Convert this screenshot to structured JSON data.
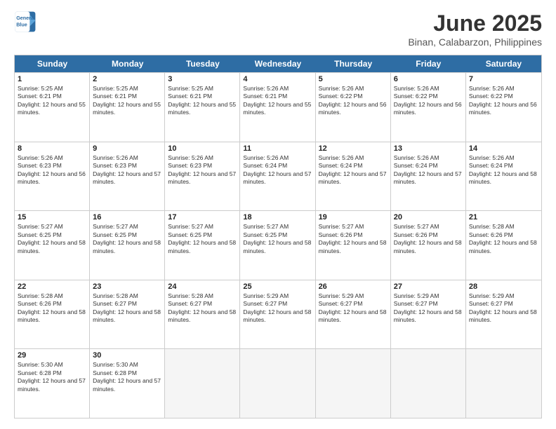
{
  "header": {
    "logo_line1": "General",
    "logo_line2": "Blue",
    "month": "June 2025",
    "location": "Binan, Calabarzon, Philippines"
  },
  "day_names": [
    "Sunday",
    "Monday",
    "Tuesday",
    "Wednesday",
    "Thursday",
    "Friday",
    "Saturday"
  ],
  "rows": [
    [
      {
        "date": "1",
        "sunrise": "5:25 AM",
        "sunset": "6:21 PM",
        "daylight": "12 hours and 55 minutes."
      },
      {
        "date": "2",
        "sunrise": "5:25 AM",
        "sunset": "6:21 PM",
        "daylight": "12 hours and 55 minutes."
      },
      {
        "date": "3",
        "sunrise": "5:25 AM",
        "sunset": "6:21 PM",
        "daylight": "12 hours and 55 minutes."
      },
      {
        "date": "4",
        "sunrise": "5:26 AM",
        "sunset": "6:21 PM",
        "daylight": "12 hours and 55 minutes."
      },
      {
        "date": "5",
        "sunrise": "5:26 AM",
        "sunset": "6:22 PM",
        "daylight": "12 hours and 56 minutes."
      },
      {
        "date": "6",
        "sunrise": "5:26 AM",
        "sunset": "6:22 PM",
        "daylight": "12 hours and 56 minutes."
      },
      {
        "date": "7",
        "sunrise": "5:26 AM",
        "sunset": "6:22 PM",
        "daylight": "12 hours and 56 minutes."
      }
    ],
    [
      {
        "date": "8",
        "sunrise": "5:26 AM",
        "sunset": "6:23 PM",
        "daylight": "12 hours and 56 minutes."
      },
      {
        "date": "9",
        "sunrise": "5:26 AM",
        "sunset": "6:23 PM",
        "daylight": "12 hours and 57 minutes."
      },
      {
        "date": "10",
        "sunrise": "5:26 AM",
        "sunset": "6:23 PM",
        "daylight": "12 hours and 57 minutes."
      },
      {
        "date": "11",
        "sunrise": "5:26 AM",
        "sunset": "6:24 PM",
        "daylight": "12 hours and 57 minutes."
      },
      {
        "date": "12",
        "sunrise": "5:26 AM",
        "sunset": "6:24 PM",
        "daylight": "12 hours and 57 minutes."
      },
      {
        "date": "13",
        "sunrise": "5:26 AM",
        "sunset": "6:24 PM",
        "daylight": "12 hours and 57 minutes."
      },
      {
        "date": "14",
        "sunrise": "5:26 AM",
        "sunset": "6:24 PM",
        "daylight": "12 hours and 58 minutes."
      }
    ],
    [
      {
        "date": "15",
        "sunrise": "5:27 AM",
        "sunset": "6:25 PM",
        "daylight": "12 hours and 58 minutes."
      },
      {
        "date": "16",
        "sunrise": "5:27 AM",
        "sunset": "6:25 PM",
        "daylight": "12 hours and 58 minutes."
      },
      {
        "date": "17",
        "sunrise": "5:27 AM",
        "sunset": "6:25 PM",
        "daylight": "12 hours and 58 minutes."
      },
      {
        "date": "18",
        "sunrise": "5:27 AM",
        "sunset": "6:25 PM",
        "daylight": "12 hours and 58 minutes."
      },
      {
        "date": "19",
        "sunrise": "5:27 AM",
        "sunset": "6:26 PM",
        "daylight": "12 hours and 58 minutes."
      },
      {
        "date": "20",
        "sunrise": "5:27 AM",
        "sunset": "6:26 PM",
        "daylight": "12 hours and 58 minutes."
      },
      {
        "date": "21",
        "sunrise": "5:28 AM",
        "sunset": "6:26 PM",
        "daylight": "12 hours and 58 minutes."
      }
    ],
    [
      {
        "date": "22",
        "sunrise": "5:28 AM",
        "sunset": "6:26 PM",
        "daylight": "12 hours and 58 minutes."
      },
      {
        "date": "23",
        "sunrise": "5:28 AM",
        "sunset": "6:27 PM",
        "daylight": "12 hours and 58 minutes."
      },
      {
        "date": "24",
        "sunrise": "5:28 AM",
        "sunset": "6:27 PM",
        "daylight": "12 hours and 58 minutes."
      },
      {
        "date": "25",
        "sunrise": "5:29 AM",
        "sunset": "6:27 PM",
        "daylight": "12 hours and 58 minutes."
      },
      {
        "date": "26",
        "sunrise": "5:29 AM",
        "sunset": "6:27 PM",
        "daylight": "12 hours and 58 minutes."
      },
      {
        "date": "27",
        "sunrise": "5:29 AM",
        "sunset": "6:27 PM",
        "daylight": "12 hours and 58 minutes."
      },
      {
        "date": "28",
        "sunrise": "5:29 AM",
        "sunset": "6:27 PM",
        "daylight": "12 hours and 58 minutes."
      }
    ],
    [
      {
        "date": "29",
        "sunrise": "5:30 AM",
        "sunset": "6:28 PM",
        "daylight": "12 hours and 57 minutes."
      },
      {
        "date": "30",
        "sunrise": "5:30 AM",
        "sunset": "6:28 PM",
        "daylight": "12 hours and 57 minutes."
      },
      {
        "date": "",
        "sunrise": "",
        "sunset": "",
        "daylight": ""
      },
      {
        "date": "",
        "sunrise": "",
        "sunset": "",
        "daylight": ""
      },
      {
        "date": "",
        "sunrise": "",
        "sunset": "",
        "daylight": ""
      },
      {
        "date": "",
        "sunrise": "",
        "sunset": "",
        "daylight": ""
      },
      {
        "date": "",
        "sunrise": "",
        "sunset": "",
        "daylight": ""
      }
    ]
  ]
}
